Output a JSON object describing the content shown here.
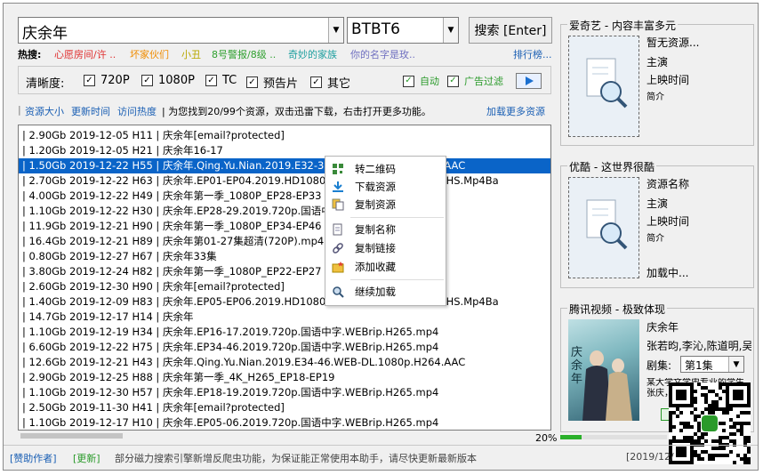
{
  "search": {
    "query": "庆余年",
    "source": "BTBT6",
    "button": "搜索 [Enter]"
  },
  "hot": {
    "label": "热搜:",
    "items": [
      {
        "text": "心愿房间/许 ..",
        "color": "#e03030"
      },
      {
        "text": "坏家伙们",
        "color": "#f08c00"
      },
      {
        "text": "小丑",
        "color": "#b8a800"
      },
      {
        "text": "8号警报/8级 ..",
        "color": "#30a030"
      },
      {
        "text": "奇妙的家族",
        "color": "#20a0a0"
      },
      {
        "text": "你的名字是玫..",
        "color": "#7070c0"
      }
    ],
    "ranking": "排行榜..."
  },
  "filters": {
    "label": "清晰度:",
    "options": [
      {
        "label": "720P",
        "checked": true
      },
      {
        "label": "1080P",
        "checked": true
      },
      {
        "label": "TC",
        "checked": true
      },
      {
        "label": "预告片",
        "checked": true
      },
      {
        "label": "其它",
        "checked": true
      }
    ],
    "auto": {
      "label": "自动",
      "checked": true
    },
    "adfilter": {
      "label": "广告过滤",
      "checked": true
    }
  },
  "sortbar": {
    "size": "资源大小",
    "time": "更新时间",
    "heat": "访问热度",
    "info": "| 为您找到20/99个资源，双击迅雷下载，右击打开更多功能。",
    "load_more": "加载更多资源"
  },
  "results": [
    "| 2.90Gb 2019-12-05 H11 | 庆余年[email?protected]",
    "| 1.20Gb 2019-12-05 H21 | 庆余年16-17",
    "| 1.50Gb 2019-12-22 H55 | 庆余年.Qing.Yu.Nian.2019.E32-33.2160p.WEB-DL.H265.AAC",
    "| 2.70Gb 2019-12-22 H63 | 庆余年.EP01-EP04.2019.HD1080P.X264.AAC.Mandarin.CHS.Mp4Ba",
    "| 4.00Gb 2019-12-22 H49 | 庆余年第一季_1080P_EP28-EP33",
    "| 1.10Gb 2019-12-22 H30 | 庆余年.EP28-29.2019.720p.国语中字.WEBrip.H265.mp4",
    "| 11.9Gb 2019-12-21 H90 | 庆余年第一季_1080P_EP34-EP46",
    "| 16.4Gb 2019-12-21 H89 | 庆余年第01-27集超清(720P).mp4",
    "| 0.80Gb 2019-12-27 H67 | 庆余年33集",
    "| 3.80Gb 2019-12-24 H82 | 庆余年第一季_1080P_EP22-EP27",
    "| 2.60Gb 2019-12-30 H90 | 庆余年[email?protected]",
    "| 1.40Gb 2019-12-09 H83 | 庆余年.EP05-EP06.2019.HD1080P.X264.AAC.Mandarin.CHS.Mp4Ba",
    "| 14.7Gb 2019-12-17 H14 | 庆余年",
    "| 1.10Gb 2019-12-19 H34 | 庆余年.EP16-17.2019.720p.国语中字.WEBrip.H265.mp4",
    "| 6.60Gb 2019-12-22 H75 | 庆余年.EP34-46.2019.720p.国语中字.WEBrip.H265.mp4",
    "| 12.6Gb 2019-12-21 H43 | 庆余年.Qing.Yu.Nian.2019.E34-46.WEB-DL.1080p.H264.AAC",
    "| 2.90Gb 2019-12-25 H88 | 庆余年第一季_4K_H265_EP18-EP19",
    "| 1.10Gb 2019-12-30 H57 | 庆余年.EP18-19.2019.720p.国语中字.WEBrip.H265.mp4",
    "| 2.50Gb 2019-11-30 H41 | 庆余年[email?protected]",
    "| 1.10Gb 2019-12-17 H10 | 庆余年.EP05-06.2019.720p.国语中字.WEBrip.H265.mp4"
  ],
  "selected_index": 2,
  "context_menu": [
    "转二维码",
    "下载资源",
    "复制资源",
    "复制名称",
    "复制链接",
    "添加收藏",
    "继续加载"
  ],
  "panels": {
    "iqiyi": {
      "title": "爱奇艺 - 内容丰富多元",
      "name": "暂无资源...",
      "actor": "主演",
      "date": "上映时间",
      "intro": "简介"
    },
    "youku": {
      "title": "优酷 - 这世界很酷",
      "name": "资源名称",
      "actor": "主演",
      "date": "上映时间",
      "intro": "简介",
      "loading": "加载中..."
    },
    "tencent": {
      "title": "腾讯视频 - 极致体现",
      "name": "庆余年",
      "actors": "张若昀,李沁,陈道明,吴",
      "episode_label": "剧集:",
      "episode": "第1集",
      "desc": "某大学文学史专业的学生张庆，以范闲的身份重生",
      "poster_text": "庆余年"
    }
  },
  "progress": {
    "text": "20%",
    "value": 0.2
  },
  "status": {
    "sponsor": "[赞助作者]",
    "update": "[更新]",
    "message": "部分磁力搜索引擎新增反爬虫功能，为保证能正常使用本助手，请尽快更新最新版本",
    "date": "[2019/12/"
  },
  "colors": {
    "selection": "#0a64c8",
    "link": "#1a5fb4",
    "green": "#2a9a2a"
  }
}
